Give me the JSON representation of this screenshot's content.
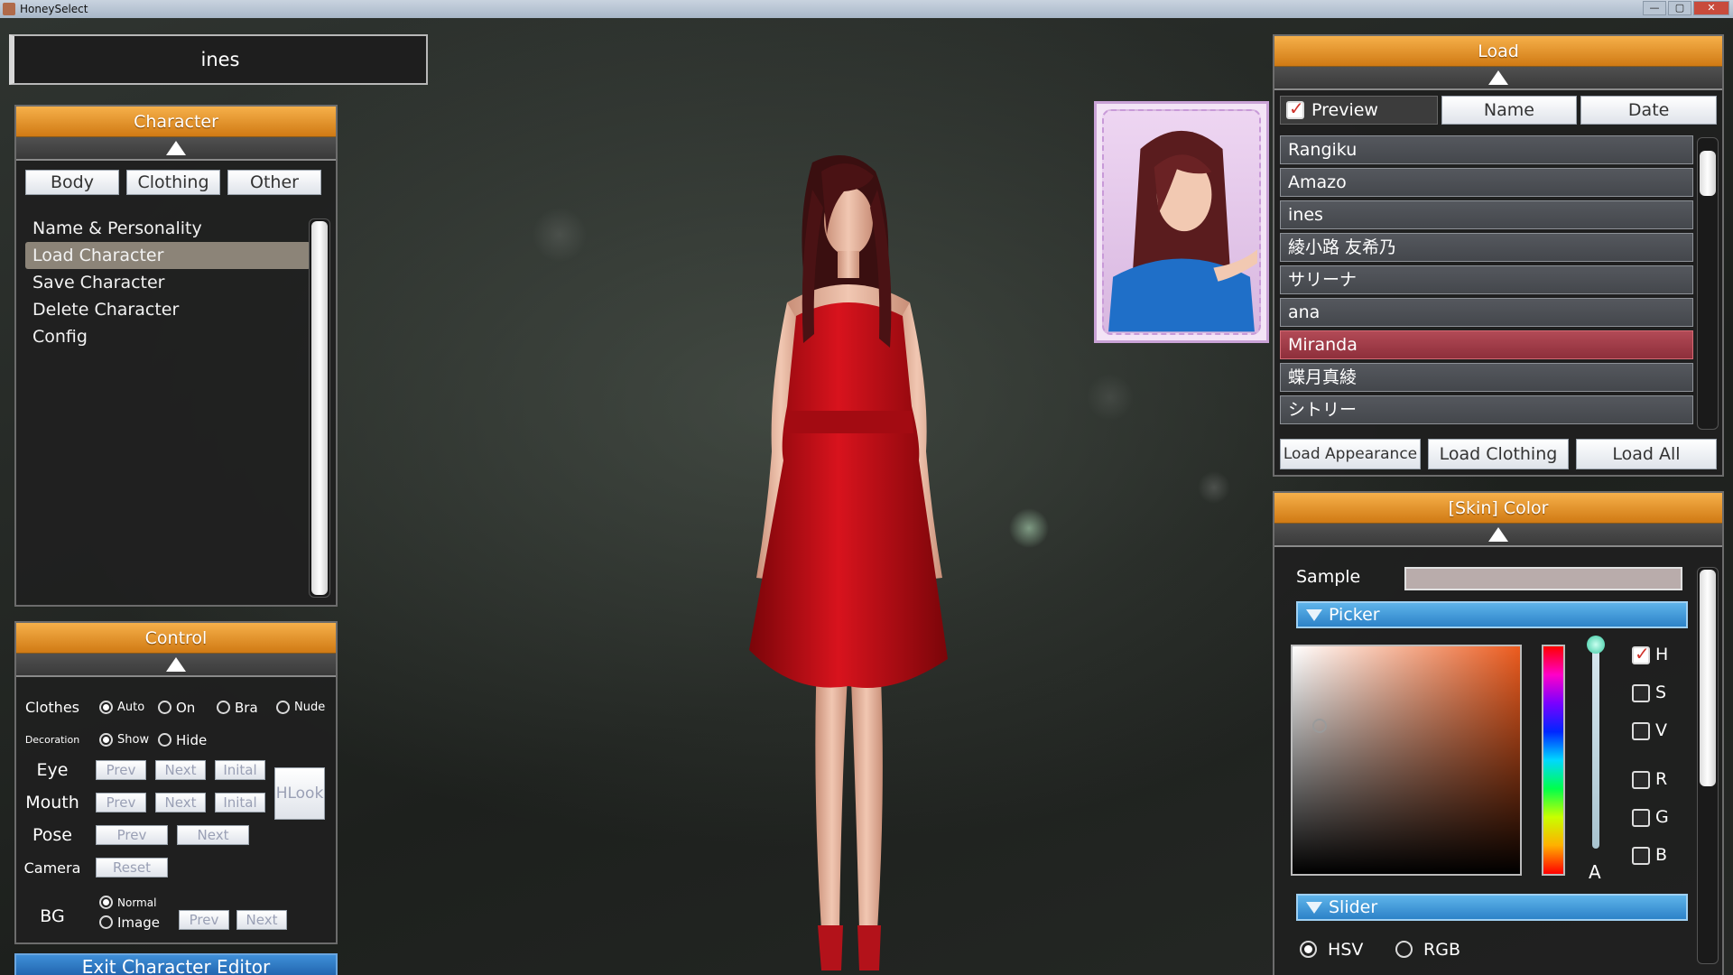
{
  "window": {
    "title": "HoneySelect",
    "minimize": "—",
    "maximize": "▢",
    "close": "✕"
  },
  "character_name": "ines",
  "character_panel": {
    "title": "Character",
    "tabs": [
      "Body",
      "Clothing",
      "Other"
    ],
    "menu": [
      "Name & Personality",
      "Load Character",
      "Save Character",
      "Delete Character",
      "Config"
    ],
    "selected_menu": "Load Character"
  },
  "control_panel": {
    "title": "Control",
    "clothes": {
      "label": "Clothes",
      "options": [
        "Auto",
        "On",
        "Bra",
        "Nude"
      ],
      "selected": "Auto"
    },
    "decoration": {
      "label": "Decoration",
      "options": [
        "Show",
        "Hide"
      ],
      "selected": "Show"
    },
    "eye": {
      "label": "Eye",
      "prev": "Prev",
      "next": "Next",
      "initial": "Inital"
    },
    "mouth": {
      "label": "Mouth",
      "prev": "Prev",
      "next": "Next",
      "initial": "Inital"
    },
    "hlook": "HLook",
    "pose": {
      "label": "Pose",
      "prev": "Prev",
      "next": "Next"
    },
    "camera": {
      "label": "Camera",
      "reset": "Reset"
    },
    "bg": {
      "label": "BG",
      "options": [
        "Normal",
        "Image"
      ],
      "selected": "Normal",
      "prev": "Prev",
      "next": "Next"
    }
  },
  "exit_button": "Exit Character Editor",
  "load_panel": {
    "title": "Load",
    "preview_label": "Preview",
    "preview_checked": true,
    "sort_name": "Name",
    "sort_date": "Date",
    "characters": [
      "Rangiku",
      "Amazo",
      "ines",
      "綾小路 友希乃",
      "サリーナ",
      "ana",
      "Miranda",
      "蝶月真綾",
      "シトリー"
    ],
    "selected_character": "Miranda",
    "actions": [
      "Load Appearance",
      "Load Clothing",
      "Load All"
    ]
  },
  "skin_color_panel": {
    "title": "[Skin] Color",
    "sample_label": "Sample",
    "sample_color": "#b9acab",
    "picker_label": "Picker",
    "hue_color": "#ec5b1e",
    "alpha_label": "A",
    "channels": [
      {
        "label": "H",
        "checked": true
      },
      {
        "label": "S",
        "checked": false
      },
      {
        "label": "V",
        "checked": false
      },
      {
        "label": "R",
        "checked": false
      },
      {
        "label": "G",
        "checked": false
      },
      {
        "label": "B",
        "checked": false
      }
    ],
    "slider_label": "Slider",
    "slider_modes": [
      "HSV",
      "RGB"
    ],
    "slider_mode_selected": "HSV"
  },
  "colors": {
    "header_orange": "#e8951f",
    "section_blue": "#3a93d6",
    "selected_row": "#a13d49",
    "dress_red": "#c0101a"
  }
}
